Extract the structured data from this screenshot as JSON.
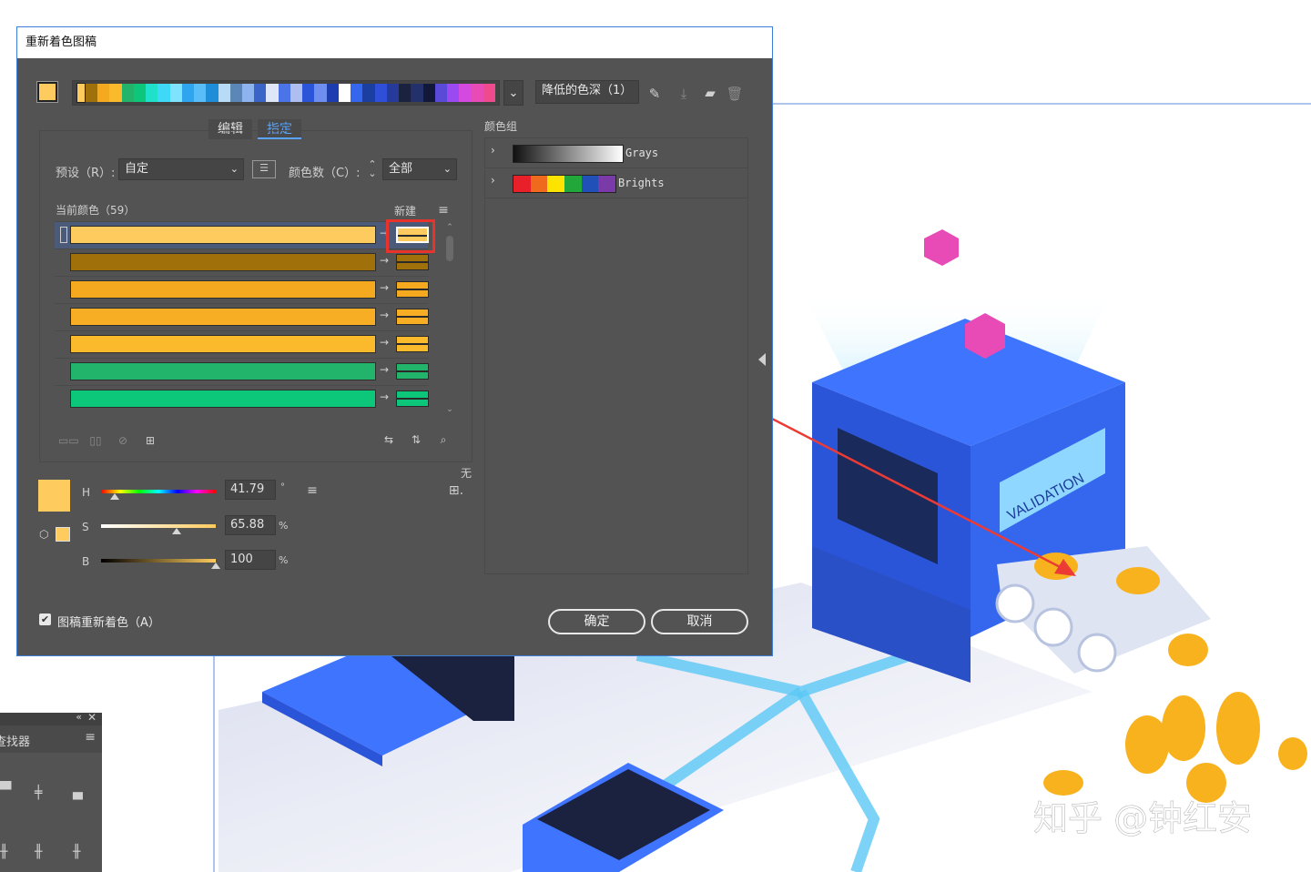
{
  "dialog": {
    "title": "重新着色图稿",
    "reduce_label": "降低的色深（1）",
    "tabs": {
      "edit": "编辑",
      "assign": "指定"
    },
    "preset_label": "预设（R）:",
    "preset_value": "自定",
    "colors_label": "颜色数（C）:",
    "colors_value": "全部",
    "current_colors_label": "当前颜色（59）",
    "new_label": "新建",
    "color_groups_label": "颜色组",
    "groups": [
      {
        "name": "Grays"
      },
      {
        "name": "Brights"
      }
    ],
    "none_label": "无",
    "hsb": {
      "h_label": "H",
      "h_value": "41.79",
      "h_unit": "°",
      "s_label": "S",
      "s_value": "65.88",
      "s_unit": "%",
      "b_label": "B",
      "b_value": "100",
      "b_unit": "%"
    },
    "recolor_art_label": "图稿重新着色（A）",
    "ok_label": "确定",
    "cancel_label": "取消",
    "current_rows": [
      {
        "color": "#fecb5e"
      },
      {
        "color": "#a0700a"
      },
      {
        "color": "#f5a91e"
      },
      {
        "color": "#f7ae25"
      },
      {
        "color": "#fbb92c"
      },
      {
        "color": "#23b46c"
      },
      {
        "color": "#0cc77a"
      }
    ],
    "accent_color": "#fecb5e"
  },
  "side_panel": {
    "title": "查找器"
  },
  "artwork": {
    "banner_text": "VALIDATION",
    "watermark": "知乎 @钟红安"
  }
}
